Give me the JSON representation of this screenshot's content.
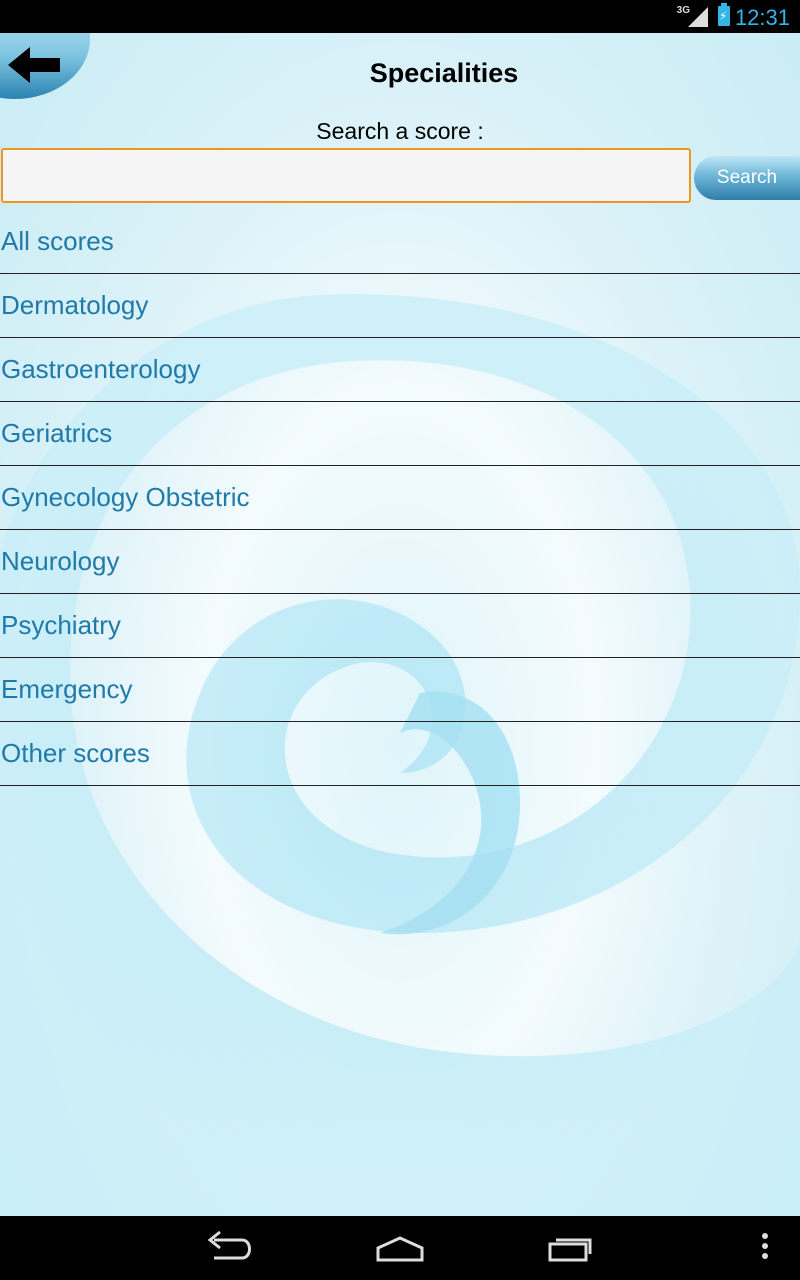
{
  "status_bar": {
    "network": "3G",
    "time": "12:31"
  },
  "header": {
    "title": "Specialities",
    "back_icon": "arrow-left-icon"
  },
  "search": {
    "label": "Search a score :",
    "value": "",
    "placeholder": "",
    "button_label": "Search"
  },
  "specialties": [
    {
      "label": "All scores"
    },
    {
      "label": "Dermatology"
    },
    {
      "label": "Gastroenterology"
    },
    {
      "label": "Geriatrics"
    },
    {
      "label": "Gynecology Obstetric"
    },
    {
      "label": "Neurology"
    },
    {
      "label": "Psychiatry"
    },
    {
      "label": "Emergency"
    },
    {
      "label": "Other scores"
    }
  ],
  "nav_bar": {
    "back_icon": "back-nav-icon",
    "home_icon": "home-icon",
    "recents_icon": "recent-apps-icon",
    "menu_icon": "overflow-menu-icon"
  },
  "colors": {
    "accent_link": "#1f7aaa",
    "input_focus": "#f0961e",
    "status_accent": "#33b5e5"
  }
}
